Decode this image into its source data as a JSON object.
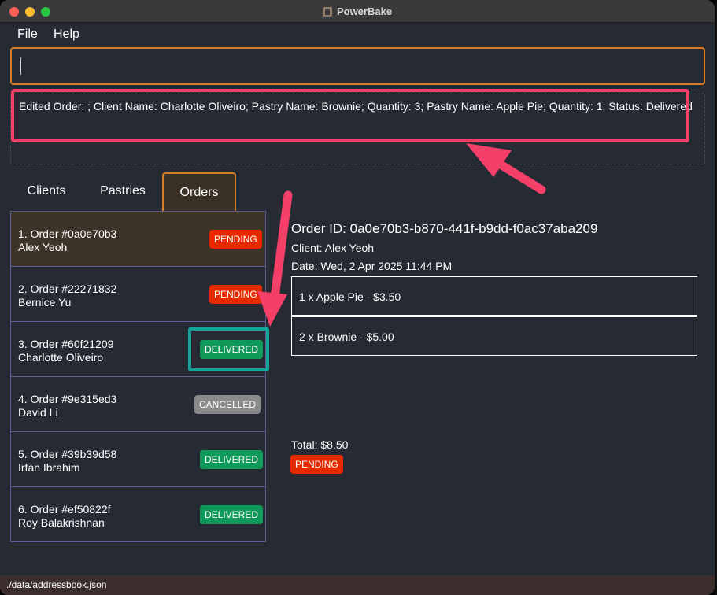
{
  "window": {
    "title": "PowerBake"
  },
  "menu": {
    "file": "File",
    "help": "Help"
  },
  "command_box": {
    "value": ""
  },
  "result": {
    "text": "Edited Order: ; Client Name: Charlotte Oliveiro; Pastry Name: Brownie; Quantity: 3; Pastry Name: Apple Pie; Quantity: 1; Status: Delivered"
  },
  "tabs": [
    {
      "label": "Clients"
    },
    {
      "label": "Pastries"
    },
    {
      "label": "Orders"
    }
  ],
  "orders": [
    {
      "number": "1. Order #0a0e70b3",
      "client": "Alex Yeoh",
      "status": "PENDING"
    },
    {
      "number": "2. Order #22271832",
      "client": "Bernice Yu",
      "status": "PENDING"
    },
    {
      "number": "3. Order #60f21209",
      "client": "Charlotte Oliveiro",
      "status": "DELIVERED"
    },
    {
      "number": "4. Order #9e315ed3",
      "client": "David Li",
      "status": "CANCELLED"
    },
    {
      "number": "5. Order #39b39d58",
      "client": "Irfan Ibrahim",
      "status": "DELIVERED"
    },
    {
      "number": "6. Order #ef50822f",
      "client": "Roy Balakrishnan",
      "status": "DELIVERED"
    }
  ],
  "detail": {
    "order_id": "Order ID: 0a0e70b3-b870-441f-b9dd-f0ac37aba209",
    "client": "Client: Alex Yeoh",
    "date": "Date: Wed, 2 Apr 2025 11:44 PM",
    "items": [
      "1 x Apple Pie - $3.50",
      "2 x Brownie - $5.00"
    ],
    "total": "Total: $8.50",
    "status": "PENDING"
  },
  "statusbar": {
    "path": "./data/addressbook.json"
  },
  "colors": {
    "accent": "#d57d25",
    "pending": "#e62a00",
    "delivered": "#109a59",
    "cancelled": "#8a8a8a",
    "annotation_pink": "#f43f69",
    "annotation_teal": "#16a39a"
  },
  "icons": {
    "app": "cake-icon"
  }
}
